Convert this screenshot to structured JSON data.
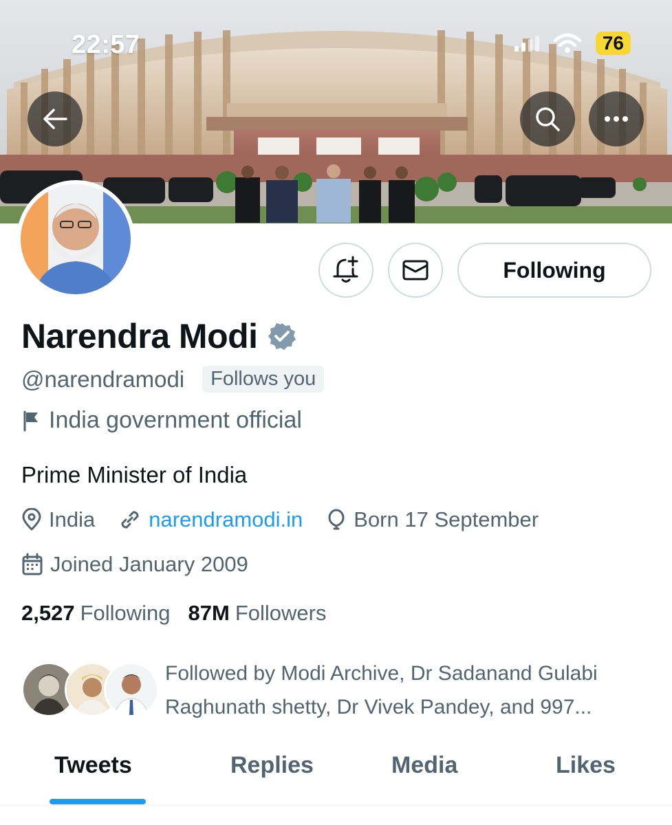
{
  "status_bar": {
    "time": "22:57",
    "battery": "76"
  },
  "header": {
    "back_icon": "back-arrow-icon",
    "search_icon": "search-icon",
    "more_icon": "more-dots-icon"
  },
  "actions": {
    "notify_icon": "bell-plus-icon",
    "message_icon": "envelope-icon",
    "following_label": "Following"
  },
  "profile": {
    "name": "Narendra Modi",
    "verified_icon": "verified-badge-icon",
    "verified_color": "#829aab",
    "handle": "@narendramodi",
    "follows_you": "Follows you",
    "affiliation": "India government official",
    "bio": "Prime Minister of India",
    "location": "India",
    "website": "narendramodi.in",
    "birthday": "Born 17 September",
    "joined": "Joined January 2009",
    "following_count": "2,527",
    "following_label": "Following",
    "followers_count": "87M",
    "followers_label": "Followers",
    "followed_by_line1": "Followed by Modi Archive, Dr Sadanand Gulabi",
    "followed_by_line2": "Raghunath shetty, Dr Vivek Pandey, and 997..."
  },
  "tabs": [
    {
      "label": "Tweets",
      "active": true
    },
    {
      "label": "Replies",
      "active": false
    },
    {
      "label": "Media",
      "active": false
    },
    {
      "label": "Likes",
      "active": false
    }
  ],
  "colors": {
    "accent": "#1d9bf0",
    "secondary_text": "#536471",
    "primary_text": "#0f1419"
  }
}
